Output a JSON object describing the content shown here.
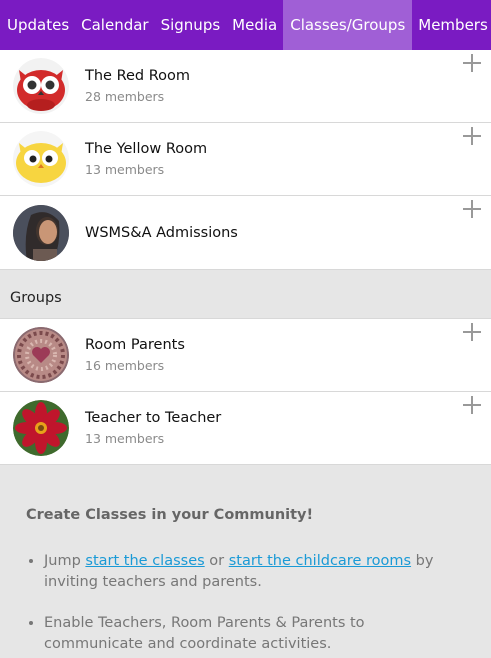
{
  "nav": {
    "tabs": [
      "Updates",
      "Calendar",
      "Signups",
      "Media",
      "Classes/Groups",
      "Members"
    ],
    "active": "Classes/Groups"
  },
  "classes": [
    {
      "name": "The Red Room",
      "members": "28 members",
      "avatar": "red-owl-icon"
    },
    {
      "name": "The Yellow Room",
      "members": "13 members",
      "avatar": "yellow-owl-icon"
    },
    {
      "name": "WSMS&A Admissions",
      "members": "",
      "avatar": "person-photo"
    }
  ],
  "groups_header": "Groups",
  "groups": [
    {
      "name": "Room Parents",
      "members": "16 members",
      "avatar": "heart-pattern-photo"
    },
    {
      "name": "Teacher to Teacher",
      "members": "13 members",
      "avatar": "red-flower-photo"
    }
  ],
  "info": {
    "heading": "Create Classes in your Community!",
    "bullet1": {
      "prefix": "Jump ",
      "link1": "start the classes",
      "middle": " or ",
      "link2": "start the childcare rooms",
      "suffix": " by inviting teachers and parents."
    },
    "bullet2": "Enable Teachers, Room Parents & Parents to communicate and coordinate activities."
  },
  "colors": {
    "nav_bg": "#7a1bc2",
    "nav_active": "#a05fd6",
    "link": "#1a9ad6"
  }
}
